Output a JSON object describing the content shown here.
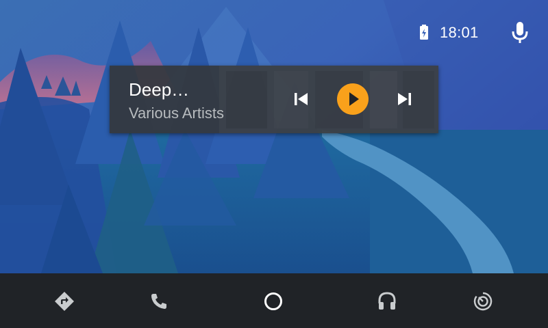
{
  "status": {
    "time": "18:01",
    "battery_icon": "battery-charging-icon",
    "mic_icon": "microphone-icon"
  },
  "media": {
    "title": "Deep…",
    "artist": "Various Artists",
    "controls": {
      "prev_icon": "skip-previous-icon",
      "play_icon": "play-icon",
      "next_icon": "skip-next-icon"
    },
    "accent": "#f9a11b"
  },
  "navbar": {
    "items": [
      {
        "id": "navigation",
        "icon": "directions-icon"
      },
      {
        "id": "phone",
        "icon": "phone-icon"
      },
      {
        "id": "home",
        "icon": "home-circle-icon"
      },
      {
        "id": "music",
        "icon": "headphones-icon"
      },
      {
        "id": "overview",
        "icon": "overview-dial-icon"
      }
    ],
    "background": "#202327"
  }
}
